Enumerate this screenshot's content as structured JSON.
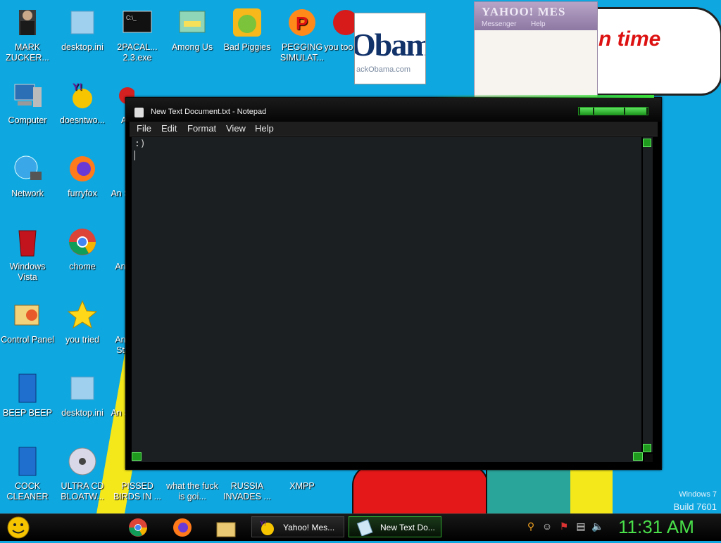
{
  "desktop_icons": [
    {
      "id": "mark-zuckerberg",
      "label": "MARK ZUCKER...",
      "col": 0,
      "row": 0,
      "icon": "person-figure-icon"
    },
    {
      "id": "desktop-ini-1",
      "label": "desktop.ini",
      "col": 1,
      "row": 0,
      "icon": "document-icon"
    },
    {
      "id": "2pacal",
      "label": "2PACAL... 2.3.exe",
      "col": 2,
      "row": 0,
      "icon": "terminal-icon"
    },
    {
      "id": "among-us",
      "label": "Among Us",
      "col": 3,
      "row": 0,
      "icon": "folder-shortcut-icon"
    },
    {
      "id": "bad-piggies",
      "label": "Bad Piggies",
      "col": 4,
      "row": 0,
      "icon": "green-pig-icon"
    },
    {
      "id": "pegging-simulator",
      "label": "PEGGING SIMULAT...",
      "col": 5,
      "row": 0,
      "icon": "p-logo-icon"
    },
    {
      "id": "you-too",
      "label": "you too s...",
      "col": 6,
      "row": 0,
      "icon": "red-badge-icon"
    },
    {
      "id": "computer",
      "label": "Computer",
      "col": 0,
      "row": 1,
      "icon": "computer-icon"
    },
    {
      "id": "doesntwork",
      "label": "doesntwo...",
      "col": 1,
      "row": 1,
      "icon": "yahoo-smiley-icon"
    },
    {
      "id": "network",
      "label": "Network",
      "col": 0,
      "row": 2,
      "icon": "network-globe-icon"
    },
    {
      "id": "furryfox",
      "label": "furryfox",
      "col": 1,
      "row": 2,
      "icon": "firefox-icon"
    },
    {
      "id": "windows-vista",
      "label": "Windows Vista",
      "col": 0,
      "row": 3,
      "icon": "recycle-bin-icon"
    },
    {
      "id": "chome",
      "label": "chome",
      "col": 1,
      "row": 3,
      "icon": "chrome-icon"
    },
    {
      "id": "control-panel",
      "label": "Control Panel",
      "col": 0,
      "row": 4,
      "icon": "control-panel-icon"
    },
    {
      "id": "you-tried",
      "label": "you tried",
      "col": 1,
      "row": 4,
      "icon": "star-icon"
    },
    {
      "id": "beep-beep",
      "label": "BEEP BEEP",
      "col": 0,
      "row": 5,
      "icon": "blue-file-icon"
    },
    {
      "id": "desktop-ini-2",
      "label": "desktop.ini",
      "col": 1,
      "row": 5,
      "icon": "document-icon"
    },
    {
      "id": "cock-cleaner",
      "label": "COCK CLEANER",
      "col": 0,
      "row": 6,
      "icon": "blue-file-icon"
    },
    {
      "id": "ultra-cd",
      "label": "ULTRA CD BLOATW...",
      "col": 1,
      "row": 6,
      "icon": "cd-disc-icon"
    },
    {
      "id": "pissed-birds",
      "label": "PISSED BIRDS IN ...",
      "col": 2,
      "row": 6,
      "icon": "bird-icon"
    },
    {
      "id": "what-the",
      "label": "what the fuck is goi...",
      "col": 3,
      "row": 6,
      "icon": "shortcut-icon"
    },
    {
      "id": "russia",
      "label": "RUSSIA INVADES ...",
      "col": 4,
      "row": 6,
      "icon": "shortcut-icon"
    },
    {
      "id": "xmpp",
      "label": "XMPP",
      "col": 5,
      "row": 6,
      "icon": "shortcut-icon"
    }
  ],
  "partial_labels": {
    "a1": "A",
    "a2": "An S",
    "a3": "An",
    "a4": "An St",
    "a5": "An S"
  },
  "wallpaper": {
    "bubble_text": "n time"
  },
  "obama_window": {
    "big_text": "Obam",
    "small_text": "ackObama.com"
  },
  "yahoo_window": {
    "title": "YAHOO! MES",
    "menu1": "Messenger",
    "menu2": "Help"
  },
  "notepad": {
    "title": "New Text Document.txt - Notepad",
    "menus": [
      "File",
      "Edit",
      "Format",
      "View",
      "Help"
    ],
    "content": ":)"
  },
  "watermark": {
    "line1": "Windows 7",
    "line2": "Build 7601"
  },
  "taskbar": {
    "tasks": [
      {
        "label": "Yahoo! Mes...",
        "icon": "yahoo-messenger-icon",
        "active": false
      },
      {
        "label": "New Text Do...",
        "icon": "notepad-icon",
        "active": true
      }
    ],
    "pinned": [
      "chrome-icon",
      "firefox-icon",
      "folder-icon"
    ],
    "tray": [
      "search-icon",
      "smiley-icon",
      "flag-icon",
      "network-icon",
      "volume-icon"
    ],
    "clock": "11:31 AM"
  },
  "colors": {
    "accent_green": "#49e04a",
    "desktop_bg": "#0fa7e0"
  }
}
